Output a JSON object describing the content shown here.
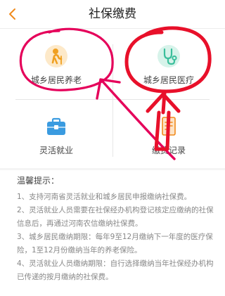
{
  "navbar": {
    "title": "社保缴费",
    "back_icon": "chevron-left-icon",
    "accent": "#f08a1c"
  },
  "menu": [
    {
      "label": "城乡居民养老",
      "icon": "elderly-person-icon",
      "color": "#f0a020"
    },
    {
      "label": "城乡居民医疗",
      "icon": "stethoscope-icon",
      "color": "#3bbf9c"
    },
    {
      "label": "灵活就业",
      "icon": "briefcase-icon",
      "color": "#3a9be0"
    },
    {
      "label": "缴费记录",
      "icon": "document-icon",
      "color": "#f08a1c"
    }
  ],
  "tips": {
    "title": "温馨提示：",
    "items": [
      "1、支持河南省灵活就业和城乡居民申报缴纳社保费。",
      "2、灵活就业人员需要在社保经办机构登记核定应缴纳的社保信息后，再通过河南农信缴纳社保费。",
      "3、城乡居民缴纳期限：每年9至12月缴纳下一年度的医疗保险，1至12月份缴纳当年的养老保险。",
      "4、灵活就业人员缴纳期限：自行选择缴纳当年社保经办机构已传递的按月缴纳的社保费。"
    ]
  },
  "annotation_color": "#e5005a"
}
